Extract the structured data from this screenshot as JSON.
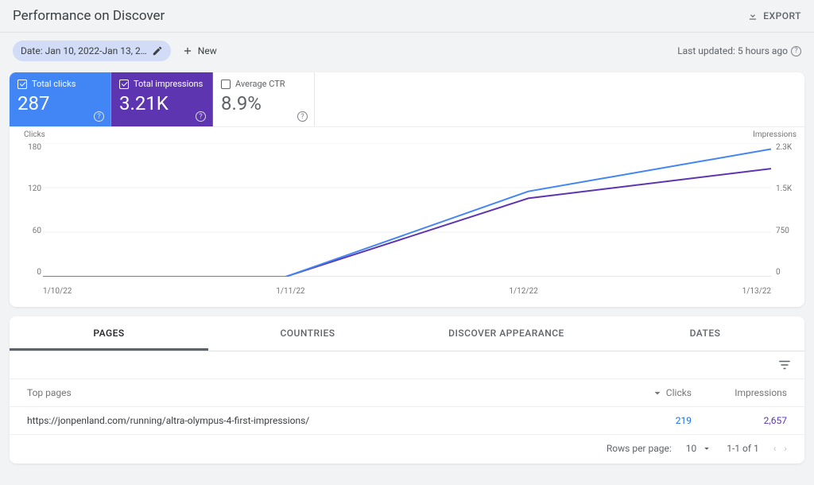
{
  "header": {
    "title": "Performance on Discover",
    "export_label": "EXPORT"
  },
  "filters": {
    "date_chip_label": "Date: Jan 10, 2022-Jan 13, 2…",
    "new_label": "New",
    "last_updated": "Last updated: 5 hours ago"
  },
  "metrics": {
    "clicks": {
      "label": "Total clicks",
      "value": "287",
      "checked": true
    },
    "impressions": {
      "label": "Total impressions",
      "value": "3.21K",
      "checked": true
    },
    "ctr": {
      "label": "Average CTR",
      "value": "8.9%",
      "checked": false
    }
  },
  "chart_data": {
    "type": "line",
    "x": [
      "1/10/22",
      "1/11/22",
      "1/12/22",
      "1/13/22"
    ],
    "series": [
      {
        "name": "Clicks",
        "axis": "left",
        "color": "#4285f4",
        "values": [
          0,
          0,
          115,
          172
        ]
      },
      {
        "name": "Impressions",
        "axis": "right",
        "color": "#5e35b1",
        "values": [
          0,
          0,
          1350,
          1860
        ]
      }
    ],
    "left_axis": {
      "label": "Clicks",
      "ticks": [
        "180",
        "120",
        "60",
        "0"
      ],
      "min": 0,
      "max": 180
    },
    "right_axis": {
      "label": "Impressions",
      "ticks": [
        "2.3K",
        "1.5K",
        "750",
        "0"
      ],
      "min": 0,
      "max": 2300
    },
    "title": "",
    "xlabel": "",
    "ylabel": ""
  },
  "table": {
    "tabs": [
      "PAGES",
      "COUNTRIES",
      "DISCOVER APPEARANCE",
      "DATES"
    ],
    "active_tab_index": 0,
    "columns": {
      "page": "Top pages",
      "clicks": "Clicks",
      "impressions": "Impressions"
    },
    "sort_column": "clicks",
    "rows": [
      {
        "page": "https://jonpenland.com/running/altra-olympus-4-first-impressions/",
        "clicks": "219",
        "impressions": "2,657"
      }
    ],
    "pager": {
      "rows_per_page_label": "Rows per page:",
      "rows_per_page_value": "10",
      "range_text": "1-1 of 1"
    }
  }
}
